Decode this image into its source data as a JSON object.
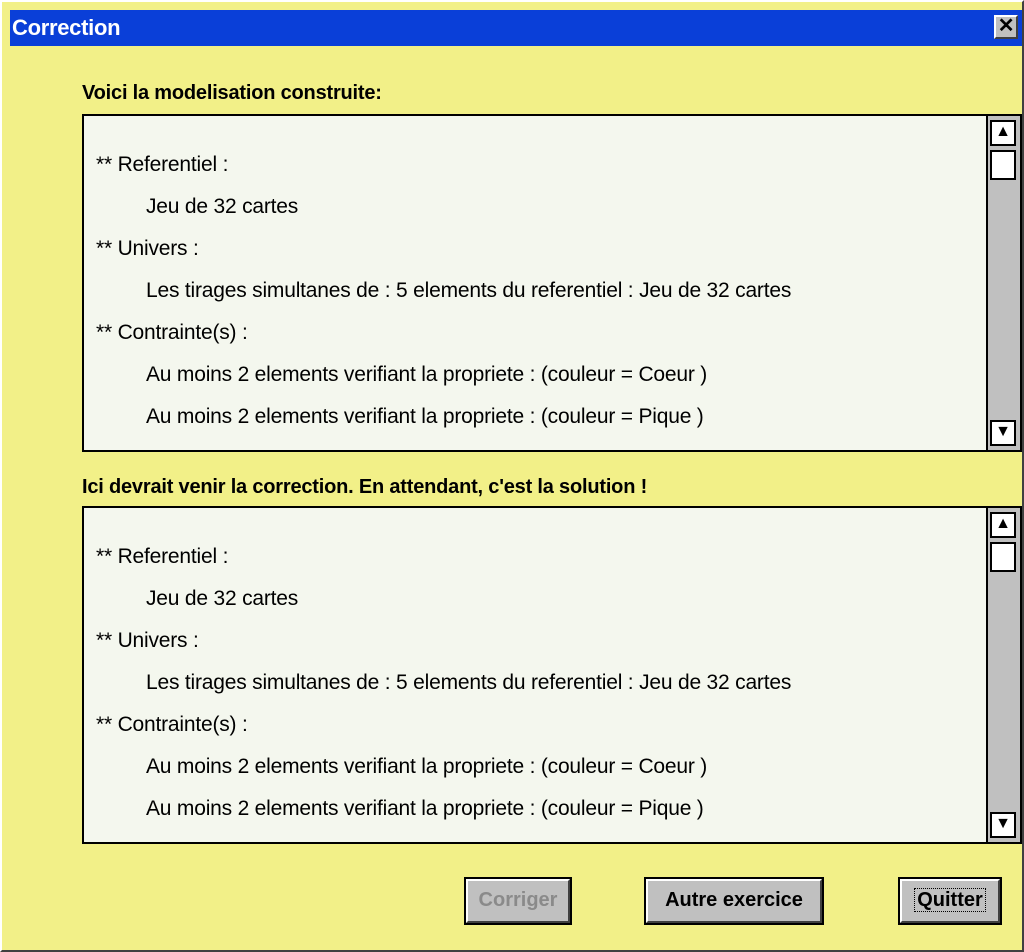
{
  "window": {
    "title": "Correction",
    "close_glyph": "✕"
  },
  "sections": [
    {
      "label": "Voici la modelisation construite:",
      "lines": [
        "** Referentiel :",
        "Jeu de 32 cartes",
        "** Univers :",
        "Les tirages simultanes de : 5 elements du referentiel : Jeu de 32 cartes",
        "** Contrainte(s) :",
        "Au moins 2 elements verifiant la propriete :  (couleur = Coeur )",
        "Au moins 2 elements verifiant la propriete :  (couleur = Pique )"
      ]
    },
    {
      "label": "Ici devrait venir la correction. En attendant, c'est la solution !",
      "lines": [
        "** Referentiel :",
        "Jeu de 32 cartes",
        "** Univers :",
        "Les tirages simultanes de : 5 elements du referentiel : Jeu de 32 cartes",
        "** Contrainte(s) :",
        "Au moins 2 elements verifiant la propriete :  (couleur = Coeur )",
        "Au moins 2 elements verifiant la propriete :  (couleur = Pique )"
      ]
    }
  ],
  "scroll_icons": {
    "up": "▲",
    "down": "▼"
  },
  "buttons": {
    "corriger": "Corriger",
    "autre": "Autre exercice",
    "quitter": "Quitter"
  },
  "colors": {
    "title_bar": "#0a3fd8",
    "client_bg": "#f2f088",
    "textbox_bg": "#f4f7ee",
    "disabled_text": "#8a8a8a"
  }
}
